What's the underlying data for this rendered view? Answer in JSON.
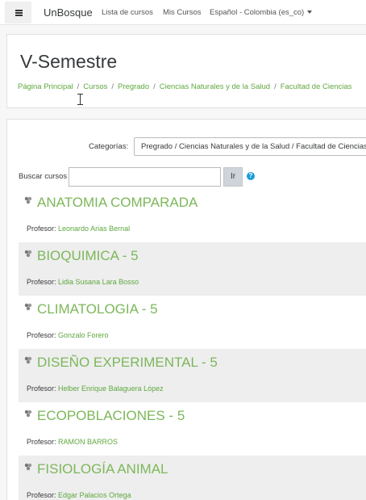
{
  "navbar": {
    "brand": "UnBosque",
    "links": [
      "Lista de cursos",
      "Mis Cursos"
    ],
    "language": "Español - Colombia (es_co)"
  },
  "header": {
    "title": "V-Semestre",
    "breadcrumb": [
      "Página Principal",
      "Cursos",
      "Pregrado",
      "Ciencias Naturales y de la Salud",
      "Facultad de Ciencias"
    ]
  },
  "filters": {
    "category_label": "Categorías:",
    "category_value": "Pregrado / Ciencias Naturales y de la Salud / Facultad de Ciencias",
    "search_label": "Buscar cursos",
    "search_value": "",
    "go_label": "Ir",
    "help_glyph": "?"
  },
  "teacher_label": "Profesor:",
  "courses": [
    {
      "name": "ANATOMIA COMPARADA",
      "teacher": "Leonardo Arias Bernal"
    },
    {
      "name": "BIOQUIMICA - 5",
      "teacher": "Lidia Susana Lara Bosso"
    },
    {
      "name": "CLIMATOLOGIA - 5",
      "teacher": "Gonzalo Forero"
    },
    {
      "name": "DISEÑO EXPERIMENTAL - 5",
      "teacher": "Helber Enrique Balaguera López"
    },
    {
      "name": "ECOPOBLACIONES - 5",
      "teacher": "RAMON BARROS"
    },
    {
      "name": "FISIOLOGÍA ANIMAL",
      "teacher": "Edgar Palacios Ortega"
    }
  ],
  "colors": {
    "link_green": "#5fa83f",
    "course_title_green": "#7cb75a",
    "help_blue": "#1a9bd7"
  },
  "icons": {
    "menu": "hamburger-menu-icon",
    "course": "course-info-icon",
    "help": "help-icon"
  }
}
